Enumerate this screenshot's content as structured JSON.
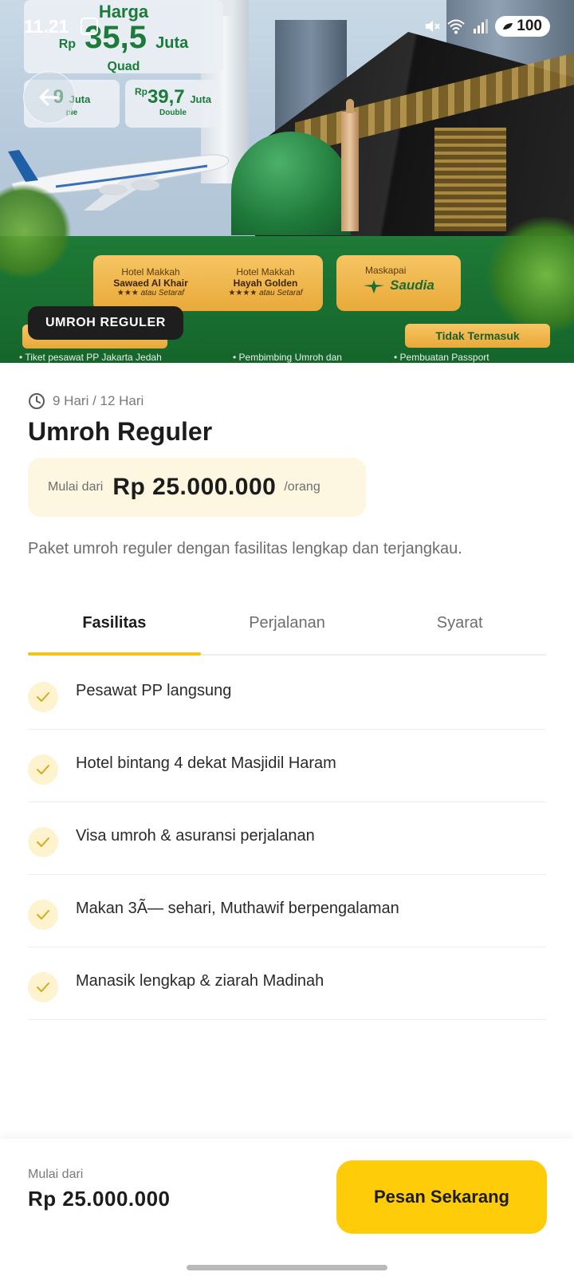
{
  "status_bar": {
    "time": "11.21",
    "battery": "100",
    "icons": [
      "screenshot-icon",
      "mute-icon",
      "wifi-icon",
      "signal-icon",
      "battery-saver-icon"
    ]
  },
  "hero": {
    "banner": {
      "harga_label": "Harga",
      "main_price_prefix": "Rp",
      "main_price": "35,5",
      "main_price_unit": "Juta",
      "main_price_room": "Quad",
      "triple_price": "9",
      "triple_unit": "Juta",
      "triple_room": "ple",
      "double_prefix": "Rp",
      "double_price": "39,7",
      "double_unit": "Juta",
      "double_room": "Double",
      "hotel_1_label": "Hotel Makkah",
      "hotel_1_name": "Sawaed Al Khair",
      "hotel_1_stars": "★★★ atau Setaraf",
      "hotel_2_label": "Hotel Makkah",
      "hotel_2_name": "Hayah Golden",
      "hotel_2_stars": "★★★★ atau Setaraf",
      "airline_label": "Maskapai",
      "airline_name": "Saudia",
      "not_included": "Tidak Termasuk",
      "bullet_1": "• Tiket pesawat PP Jakarta Jedah",
      "bullet_2": "• Pembimbing Umroh dan",
      "bullet_3": "• Pembuatan Passport"
    },
    "badge": "UMROH REGULER"
  },
  "package": {
    "duration": "9 Hari / 12 Hari",
    "title": "Umroh Reguler",
    "price_label": "Mulai dari",
    "price": "Rp 25.000.000",
    "price_unit": "/orang",
    "description": "Paket umroh reguler dengan fasilitas lengkap dan terjangkau."
  },
  "tabs": [
    {
      "label": "Fasilitas",
      "active": true
    },
    {
      "label": "Perjalanan",
      "active": false
    },
    {
      "label": "Syarat",
      "active": false
    }
  ],
  "facilities": [
    "Pesawat PP langsung",
    "Hotel bintang 4 dekat Masjidil Haram",
    "Visa umroh & asuransi perjalanan",
    "Makan 3Ã— sehari, Muthawif berpengalaman",
    "Manasik lengkap & ziarah Madinah"
  ],
  "bottom_bar": {
    "label": "Mulai dari",
    "price": "Rp 25.000.000",
    "button": "Pesan Sekarang"
  },
  "colors": {
    "accent": "#ffcc0a",
    "tab_indicator": "#f2c318",
    "price_box_bg": "#fdf6e1",
    "check_bg": "#fdf3cf",
    "badge_bg": "#1e1e1e",
    "banner_green": "#1b7b3a"
  }
}
